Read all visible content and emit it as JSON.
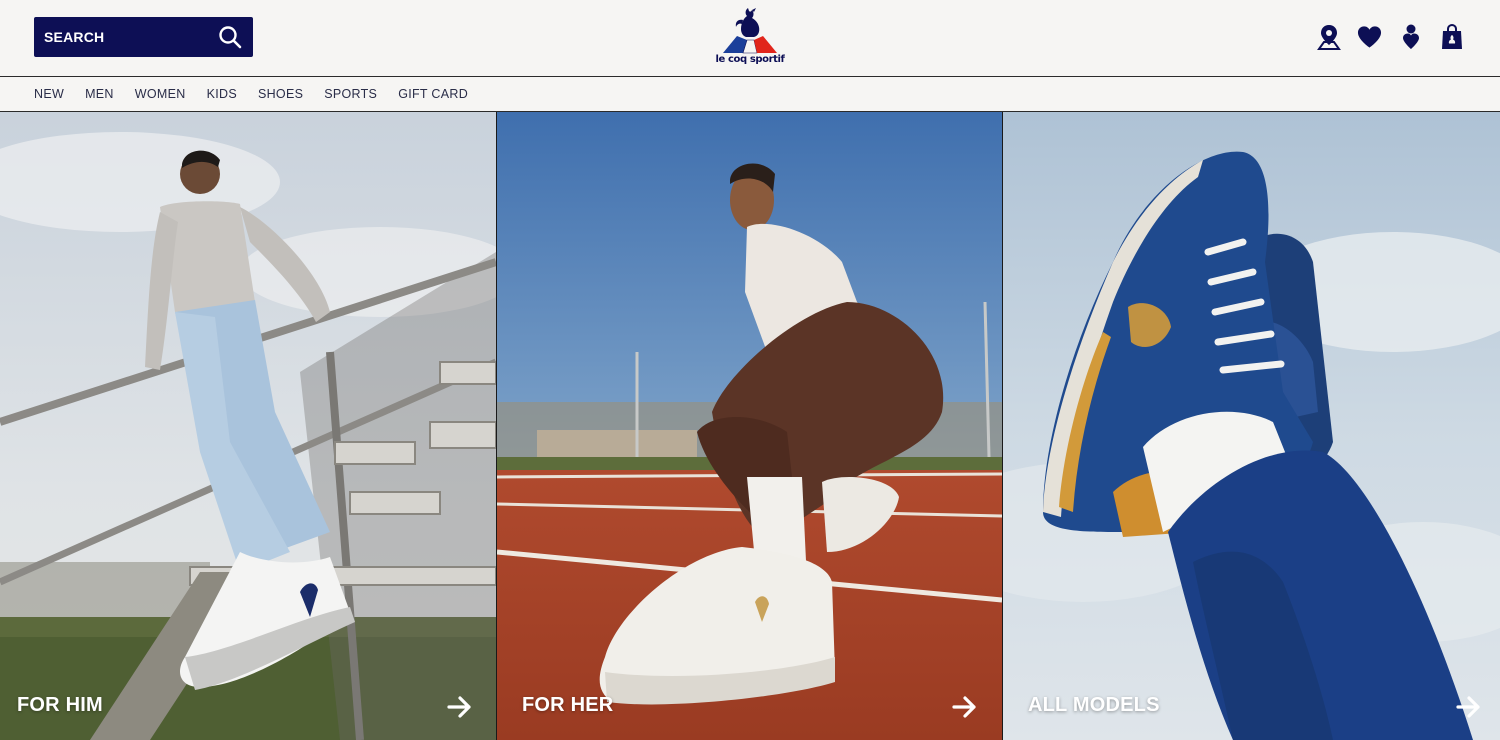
{
  "header": {
    "search": {
      "label": "SEARCH",
      "icon": "search-icon"
    },
    "logo": {
      "text": "le coq sportif",
      "colors": {
        "blue": "#1b3f9a",
        "red": "#e1251b",
        "navy": "#0d0f55"
      }
    },
    "icons": [
      {
        "name": "store-locator-icon"
      },
      {
        "name": "wishlist-heart-icon"
      },
      {
        "name": "account-icon"
      },
      {
        "name": "cart-bag-icon"
      }
    ]
  },
  "nav": {
    "items": [
      {
        "label": "NEW"
      },
      {
        "label": "MEN"
      },
      {
        "label": "WOMEN"
      },
      {
        "label": "KIDS"
      },
      {
        "label": "SHOES"
      },
      {
        "label": "SPORTS"
      },
      {
        "label": "GIFT CARD"
      }
    ]
  },
  "panels": [
    {
      "label": "FOR HIM",
      "arrow": "arrow-right-icon"
    },
    {
      "label": "FOR HER",
      "arrow": "arrow-right-icon"
    },
    {
      "label": "ALL MODELS",
      "arrow": "arrow-right-icon"
    }
  ],
  "colors": {
    "brand_navy": "#0d0f55",
    "background": "#f6f5f3",
    "text": "#2a2d48"
  }
}
